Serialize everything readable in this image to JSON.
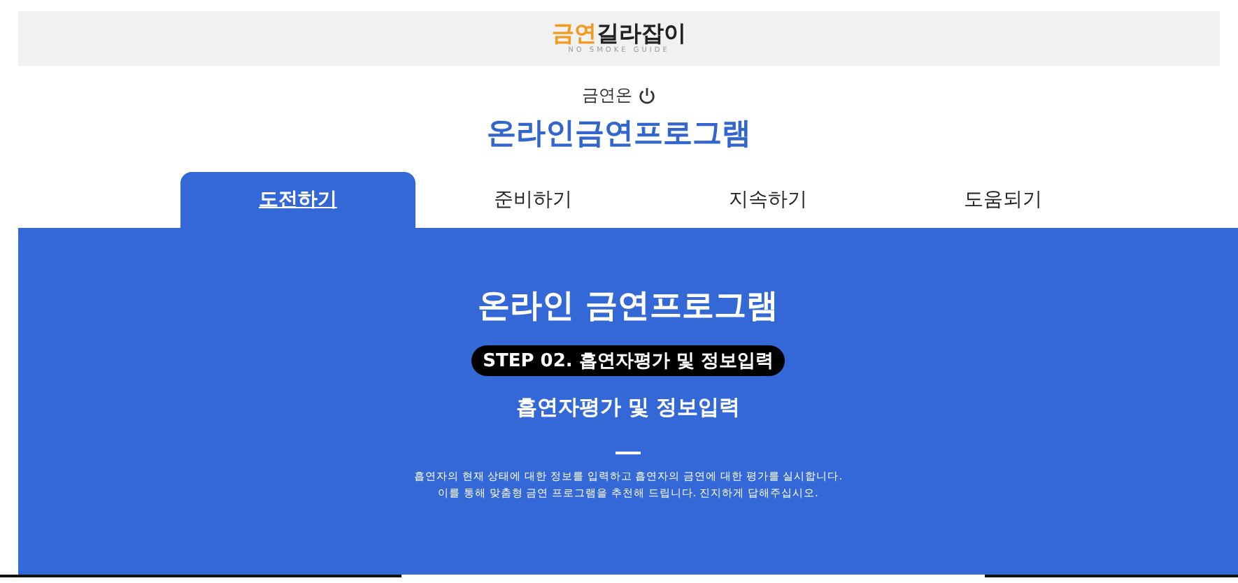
{
  "header": {
    "logo_highlight": "금연",
    "logo_rest": "길라잡이",
    "logo_subtitle": "NO SMOKE GUIDE"
  },
  "site": {
    "label": "금연온",
    "title": "온라인금연프로그램"
  },
  "tabs": [
    {
      "label": "도전하기",
      "selected": true
    },
    {
      "label": "준비하기",
      "selected": false
    },
    {
      "label": "지속하기",
      "selected": false
    },
    {
      "label": "도움되기",
      "selected": false
    }
  ],
  "hero": {
    "title": "온라인 금연프로그램",
    "step": "STEP 02. 흡연자평가 및 정보입력",
    "subtitle": "흡연자평가 및 정보입력",
    "description": [
      "흡연자의 현재 상태에 대한 정보를 입력하고 흡연자의 금연에 대한 평가를 실시합니다.",
      "이를 통해 맞춤형 금연 프로그램을 추천해 드립니다. 진지하게 답해주십시오."
    ]
  }
}
